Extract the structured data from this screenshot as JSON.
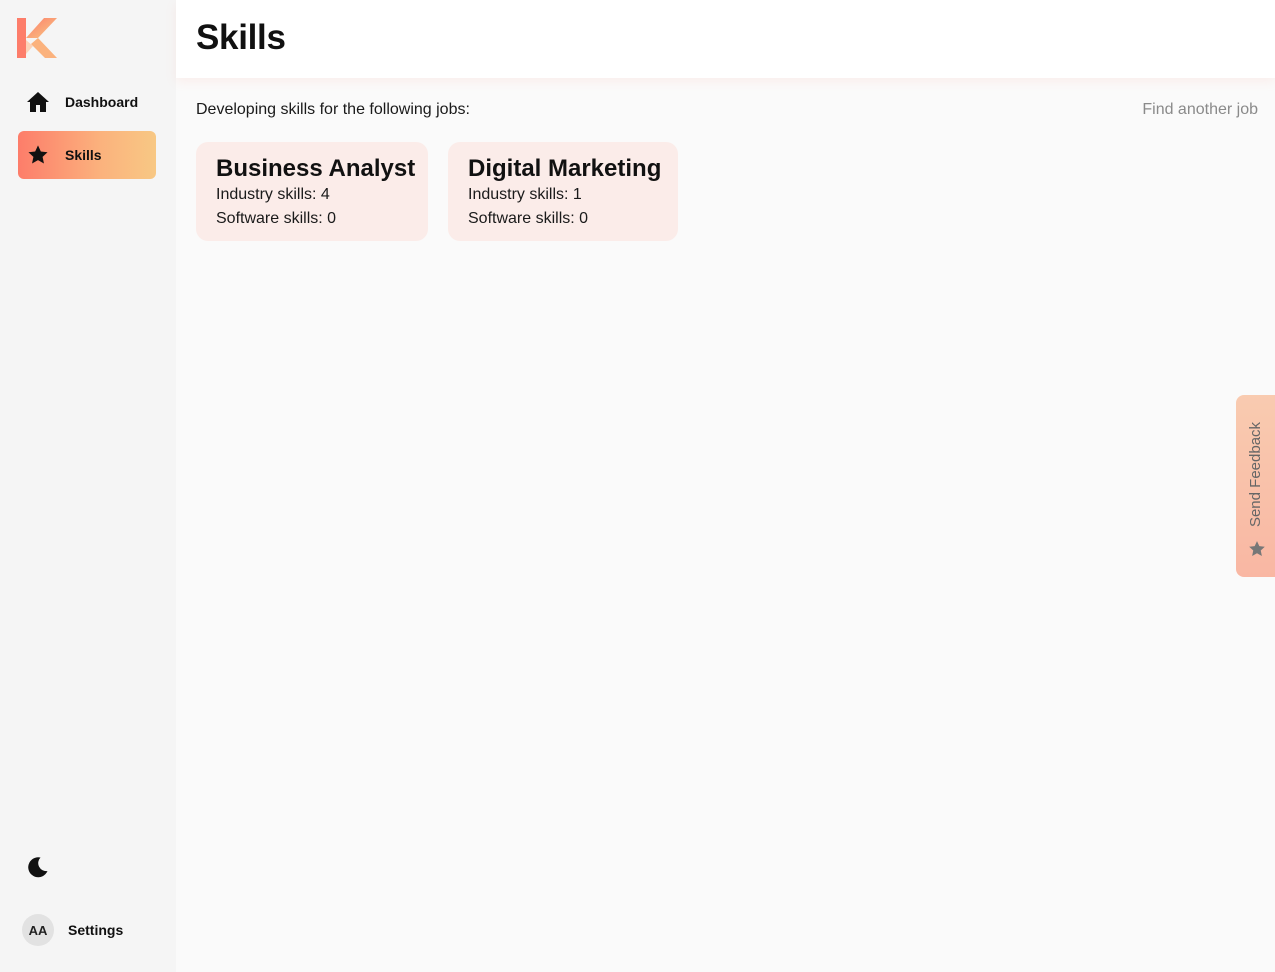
{
  "sidebar": {
    "logo_icon": "k-logo-icon",
    "items": [
      {
        "label": "Dashboard",
        "icon": "home-icon",
        "active": false
      },
      {
        "label": "Skills",
        "icon": "star-icon",
        "active": true
      }
    ],
    "theme_toggle_icon": "moon-icon",
    "user": {
      "initials": "AA",
      "settings_label": "Settings"
    }
  },
  "header": {
    "title": "Skills"
  },
  "main": {
    "intro": "Developing skills for the following jobs:",
    "find_link": "Find another job",
    "jobs": [
      {
        "title": "Business Analyst",
        "industry": "Industry skills: 4",
        "software": "Software skills: 0"
      },
      {
        "title": "Digital Marketing",
        "industry": "Industry skills: 1",
        "software": "Software skills: 0"
      }
    ]
  },
  "feedback": {
    "label": "Send Feedback",
    "icon": "star-icon"
  },
  "colors": {
    "accent_start": "#fd7d6a",
    "accent_end": "#f8c884",
    "card_bg": "#fbece9"
  }
}
